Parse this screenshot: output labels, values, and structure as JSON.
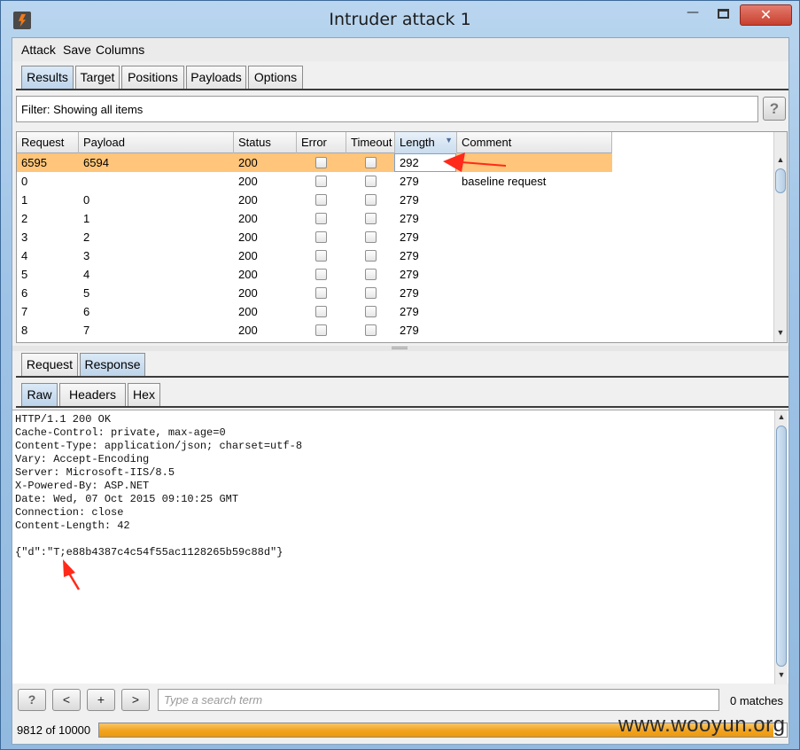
{
  "window": {
    "title": "Intruder attack 1",
    "minimize": "—",
    "close": "✕"
  },
  "menu": [
    "Attack",
    "Save",
    "Columns"
  ],
  "main_tabs": [
    {
      "label": "Results",
      "active": true
    },
    {
      "label": "Target",
      "active": false
    },
    {
      "label": "Positions",
      "active": false
    },
    {
      "label": "Payloads",
      "active": false
    },
    {
      "label": "Options",
      "active": false
    }
  ],
  "filter": {
    "text": "Filter: Showing all items",
    "help": "?"
  },
  "table": {
    "columns": [
      "Request",
      "Payload",
      "Status",
      "Error",
      "Timeout",
      "Length",
      "Comment"
    ],
    "sorted_column": "Length",
    "rows": [
      {
        "request": "6595",
        "payload": "6594",
        "status": "200",
        "length": "292",
        "comment": "",
        "selected": true
      },
      {
        "request": "0",
        "payload": "",
        "status": "200",
        "length": "279",
        "comment": "baseline request",
        "selected": false
      },
      {
        "request": "1",
        "payload": "0",
        "status": "200",
        "length": "279",
        "comment": "",
        "selected": false
      },
      {
        "request": "2",
        "payload": "1",
        "status": "200",
        "length": "279",
        "comment": "",
        "selected": false
      },
      {
        "request": "3",
        "payload": "2",
        "status": "200",
        "length": "279",
        "comment": "",
        "selected": false
      },
      {
        "request": "4",
        "payload": "3",
        "status": "200",
        "length": "279",
        "comment": "",
        "selected": false
      },
      {
        "request": "5",
        "payload": "4",
        "status": "200",
        "length": "279",
        "comment": "",
        "selected": false
      },
      {
        "request": "6",
        "payload": "5",
        "status": "200",
        "length": "279",
        "comment": "",
        "selected": false
      },
      {
        "request": "7",
        "payload": "6",
        "status": "200",
        "length": "279",
        "comment": "",
        "selected": false
      },
      {
        "request": "8",
        "payload": "7",
        "status": "200",
        "length": "279",
        "comment": "",
        "selected": false
      }
    ]
  },
  "detail_tabs": [
    {
      "label": "Request",
      "active": false
    },
    {
      "label": "Response",
      "active": true
    }
  ],
  "view_tabs": [
    {
      "label": "Raw",
      "active": true
    },
    {
      "label": "Headers",
      "active": false
    },
    {
      "label": "Hex",
      "active": false
    }
  ],
  "response_lines": [
    "HTTP/1.1 200 OK",
    "Cache-Control: private, max-age=0",
    "Content-Type: application/json; charset=utf-8",
    "Vary: Accept-Encoding",
    "Server: Microsoft-IIS/8.5",
    "X-Powered-By: ASP.NET",
    "Date: Wed, 07 Oct 2015 09:10:25 GMT",
    "Connection: close",
    "Content-Length: 42",
    "",
    "{\"d\":\"T;e88b4387c4c54f55ac1128265b59c88d\"}"
  ],
  "search": {
    "help": "?",
    "prev": "<",
    "add": "+",
    "next": ">",
    "placeholder": "Type a search term",
    "matches": "0 matches"
  },
  "progress": {
    "text": "9812 of 10000",
    "fraction": 0.9812
  },
  "watermark": "www.wooyun.org",
  "colors": {
    "selected_row": "#ffc57a",
    "annotation_arrow": "#ff2a1a",
    "progress_fill": "#f3a21c"
  }
}
